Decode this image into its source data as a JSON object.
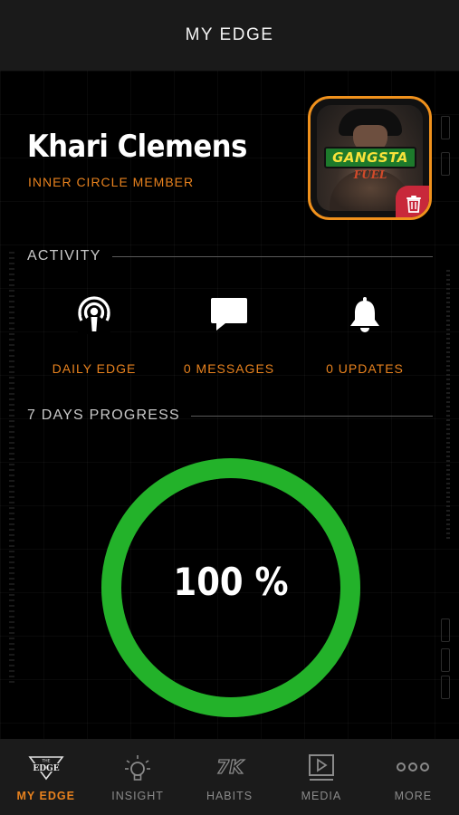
{
  "header": {
    "title": "MY EDGE"
  },
  "profile": {
    "name": "Khari Clemens",
    "membership": "INNER CIRCLE MEMBER",
    "avatar_logo_top": "GANGSTA",
    "avatar_logo_bottom": "FUEL",
    "delete_icon": "trash-icon"
  },
  "activity": {
    "heading": "ACTIVITY",
    "items": [
      {
        "icon": "podcast-icon",
        "label": "DAILY EDGE"
      },
      {
        "icon": "message-icon",
        "label": "0 MESSAGES"
      },
      {
        "icon": "bell-icon",
        "label": "0 UPDATES"
      }
    ]
  },
  "progress": {
    "heading": "7 DAYS PROGRESS",
    "value_text": "100 %",
    "percent": 100,
    "ring_color": "#23b22a"
  },
  "tabs": [
    {
      "label": "MY EDGE",
      "icon": "edge-logo-icon",
      "active": true,
      "logo_text": "THE EDGE"
    },
    {
      "label": "INSIGHT",
      "icon": "lightbulb-icon",
      "active": false
    },
    {
      "label": "HABITS",
      "icon": "7k-icon",
      "active": false,
      "icon_text": "7K"
    },
    {
      "label": "MEDIA",
      "icon": "play-icon",
      "active": false
    },
    {
      "label": "MORE",
      "icon": "more-icon",
      "active": false
    }
  ],
  "colors": {
    "accent": "#e8821e",
    "ring": "#23b22a",
    "delete": "#c8283a"
  }
}
